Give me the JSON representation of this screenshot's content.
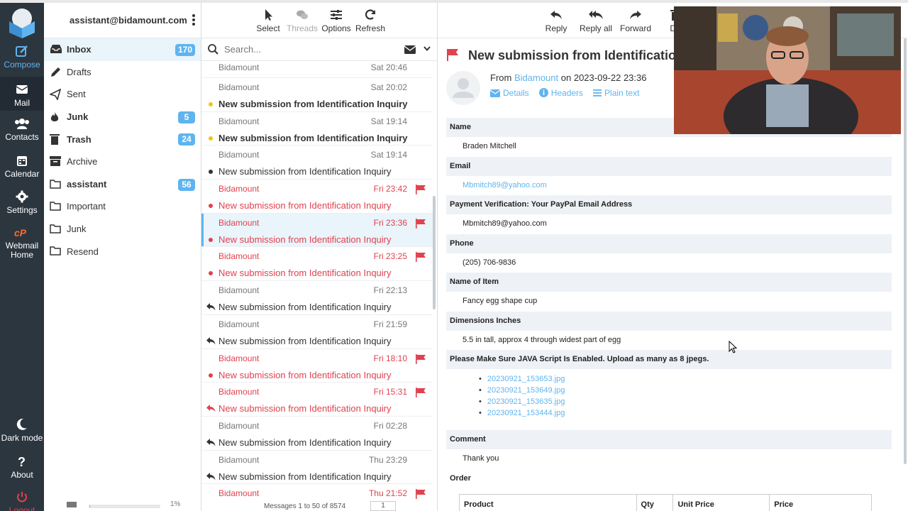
{
  "account": {
    "email": "assistant@bidamount.com"
  },
  "nav": {
    "compose": "Compose",
    "mail": "Mail",
    "contacts": "Contacts",
    "calendar": "Calendar",
    "settings": "Settings",
    "webmail_home": "Webmail Home",
    "dark_mode": "Dark mode",
    "about": "About",
    "logout": "Logout"
  },
  "folders": [
    {
      "name": "Inbox",
      "count": "170",
      "icon": "inbox-icon"
    },
    {
      "name": "Drafts",
      "count": "",
      "icon": "pencil-icon"
    },
    {
      "name": "Sent",
      "count": "",
      "icon": "paper-plane-icon"
    },
    {
      "name": "Junk",
      "count": "5",
      "icon": "fire-icon"
    },
    {
      "name": "Trash",
      "count": "24",
      "icon": "trash-icon"
    },
    {
      "name": "Archive",
      "count": "",
      "icon": "archive-icon"
    },
    {
      "name": "assistant",
      "count": "56",
      "icon": "folder-icon"
    },
    {
      "name": "Important",
      "count": "",
      "icon": "folder-icon"
    },
    {
      "name": "Junk",
      "count": "",
      "icon": "folder-icon"
    },
    {
      "name": "Resend",
      "count": "",
      "icon": "folder-icon"
    }
  ],
  "quota": {
    "percent_text": "1%",
    "fill": 0.01
  },
  "list_toolbar": {
    "select": "Select",
    "threads": "Threads",
    "options": "Options",
    "refresh": "Refresh"
  },
  "search": {
    "placeholder": "Search..."
  },
  "messages": [
    {
      "from": "Bidamount",
      "date": "Sat 20:46",
      "subject": "",
      "state": "first"
    },
    {
      "from": "Bidamount",
      "date": "Sat 20:02",
      "subject": "New submission from Identification Inquiry",
      "state": "unread"
    },
    {
      "from": "Bidamount",
      "date": "Sat 19:14",
      "subject": "New submission from Identification Inquiry",
      "state": "unread"
    },
    {
      "from": "Bidamount",
      "date": "Sat 19:14",
      "subject": "New submission from Identification Inquiry",
      "state": "read"
    },
    {
      "from": "Bidamount",
      "date": "Fri 23:42",
      "subject": "New submission from Identification Inquiry",
      "state": "flagged"
    },
    {
      "from": "Bidamount",
      "date": "Fri 23:36",
      "subject": "New submission from Identification Inquiry",
      "state": "flagged-selected"
    },
    {
      "from": "Bidamount",
      "date": "Fri 23:25",
      "subject": "New submission from Identification Inquiry",
      "state": "flagged"
    },
    {
      "from": "Bidamount",
      "date": "Fri 22:13",
      "subject": "New submission from Identification Inquiry",
      "state": "replied"
    },
    {
      "from": "Bidamount",
      "date": "Fri 21:59",
      "subject": "New submission from Identification Inquiry",
      "state": "replied"
    },
    {
      "from": "Bidamount",
      "date": "Fri 18:10",
      "subject": "New submission from Identification Inquiry",
      "state": "flagged"
    },
    {
      "from": "Bidamount",
      "date": "Fri 15:31",
      "subject": "New submission from Identification Inquiry",
      "state": "flagged-replied"
    },
    {
      "from": "Bidamount",
      "date": "Fri 02:28",
      "subject": "New submission from Identification Inquiry",
      "state": "replied"
    },
    {
      "from": "Bidamount",
      "date": "Thu 23:29",
      "subject": "New submission from Identification Inquiry",
      "state": "replied"
    },
    {
      "from": "Bidamount",
      "date": "Thu 21:52",
      "subject": "New submission from Identification Inquiry",
      "state": "flagged-replied"
    }
  ],
  "pager": {
    "text": "Messages 1 to 50 of 8574",
    "page": "1"
  },
  "read_toolbar": {
    "reply": "Reply",
    "reply_all": "Reply all",
    "forward": "Forward",
    "delete": "De"
  },
  "email": {
    "subject": "New submission from Identification",
    "from_prefix": "From",
    "from_name": "Bidamount",
    "on": "on",
    "date": "2023-09-22 23:36",
    "details": "Details",
    "headers": "Headers",
    "plain_text": "Plain text",
    "fields": [
      {
        "label": "Name",
        "value": "Braden Mitchell",
        "link": false
      },
      {
        "label": "Email",
        "value": "Mbmitch89@yahoo.com",
        "link": true
      },
      {
        "label": "Payment Verification: Your PayPal Email Address",
        "value": "Mbmitch89@yahoo.com",
        "link": false
      },
      {
        "label": "Phone",
        "value": "(205) 706-9836",
        "link": false
      },
      {
        "label": "Name of Item",
        "value": "Fancy egg shape cup",
        "link": false
      },
      {
        "label": "Dimensions Inches",
        "value": "5.5 in tall, approx 4 through widest part of egg",
        "link": false
      }
    ],
    "upload_label": "Please Make Sure JAVA Script Is Enabled. Upload as many as 8 jpegs.",
    "files": [
      "20230921_153653.jpg",
      "20230921_153649.jpg",
      "20230921_153635.jpg",
      "20230921_153444.jpg"
    ],
    "comment_label": "Comment",
    "comment": "Thank you",
    "order_label": "Order",
    "order_headers": [
      "Product",
      "Qty",
      "Unit Price",
      "Price"
    ]
  },
  "colors": {
    "accent": "#5fb4ef",
    "flag": "#e0424f",
    "rail": "#2c363f",
    "unread_dot": "#f0c419"
  }
}
